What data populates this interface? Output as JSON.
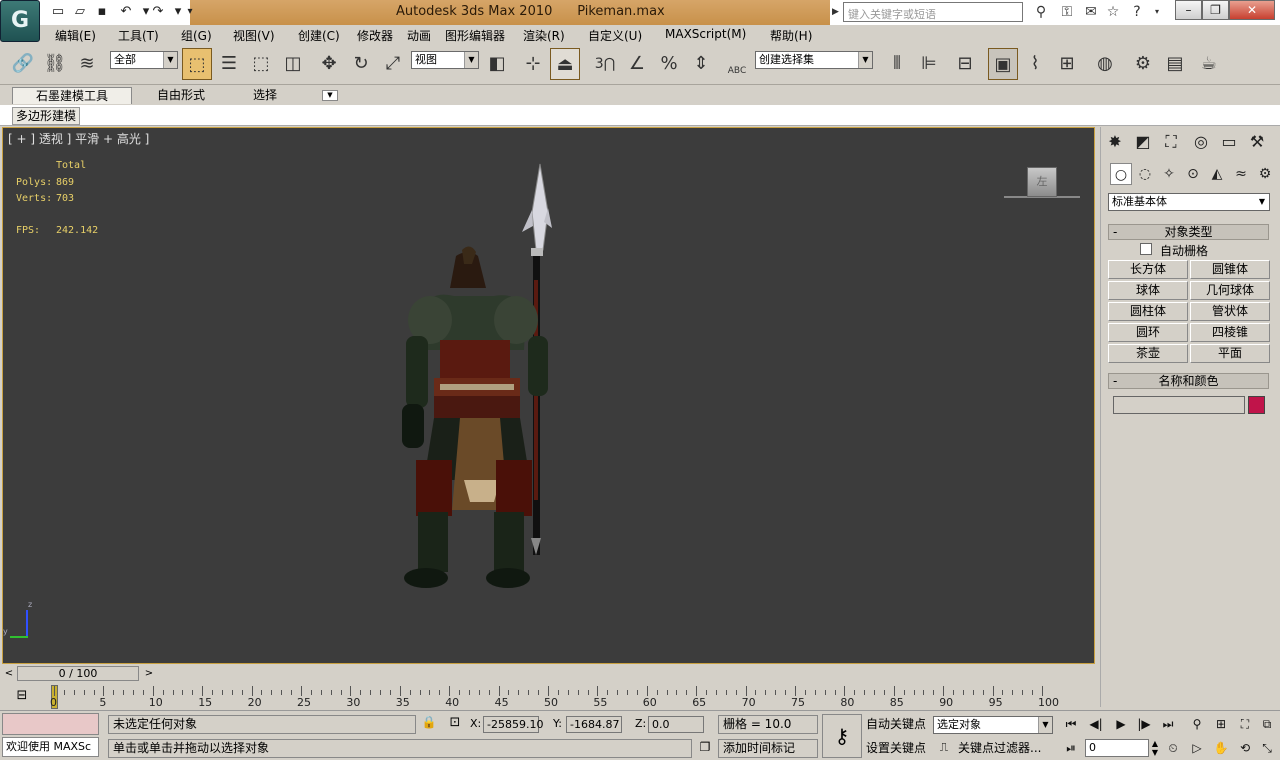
{
  "title": {
    "app": "Autodesk 3ds Max  2010",
    "file": "Pikeman.max",
    "search_placeholder": "键入关键字或短语"
  },
  "menus": [
    "编辑(E)",
    "工具(T)",
    "组(G)",
    "视图(V)",
    "创建(C)",
    "修改器",
    "动画",
    "图形编辑器",
    "渲染(R)",
    "自定义(U)",
    "MAXScript(M)",
    "帮助(H)"
  ],
  "toolbar": {
    "selection_filter": "全部",
    "ref_coord": "视图",
    "named_selection": "创建选择集",
    "snap_3": "3",
    "abc": "ABC"
  },
  "ribbon": {
    "tabs": [
      "石墨建模工具",
      "自由形式",
      "选择"
    ],
    "subtab": "多边形建模"
  },
  "viewport": {
    "label": "[ + ] 透视 ] 平滑 + 高光 ]",
    "stats_header": "Total",
    "polys_label": "Polys:",
    "polys_value": "869",
    "verts_label": "Verts:",
    "verts_value": "703",
    "fps_label": "FPS:",
    "fps_value": "242.142",
    "axis_z": "z",
    "axis_y": "y",
    "viewcube_label": "左"
  },
  "command_panel": {
    "primitive_category": "标准基本体",
    "object_type_header": "对象类型",
    "autogrid_label": "自动栅格",
    "primitives": [
      "长方体",
      "圆锥体",
      "球体",
      "几何球体",
      "圆柱体",
      "管状体",
      "圆环",
      "四棱锥",
      "茶壶",
      "平面"
    ],
    "name_color_header": "名称和颜色",
    "object_color": "#c0144a"
  },
  "timeline": {
    "frame_display": "0 / 100",
    "ticks": [
      "0",
      "5",
      "10",
      "15",
      "20",
      "25",
      "30",
      "35",
      "40",
      "45",
      "50",
      "55",
      "60",
      "65",
      "70",
      "75",
      "80",
      "85",
      "90",
      "95",
      "100"
    ]
  },
  "status": {
    "maxscript_listener": "欢迎使用 MAXSc",
    "selection_info": "未选定任何对象",
    "prompt": "单击或单击并拖动以选择对象",
    "x_label": "X:",
    "x_value": "-25859.10",
    "y_label": "Y:",
    "y_value": "-1684.87",
    "z_label": "Z:",
    "z_value": "0.0",
    "grid": "栅格 = 10.0",
    "add_time_tag": "添加时间标记",
    "auto_key": "自动关键点",
    "set_key": "设置关键点",
    "key_mode_select": "选定对象",
    "key_filters": "关键点过滤器...",
    "current_frame": "0"
  }
}
